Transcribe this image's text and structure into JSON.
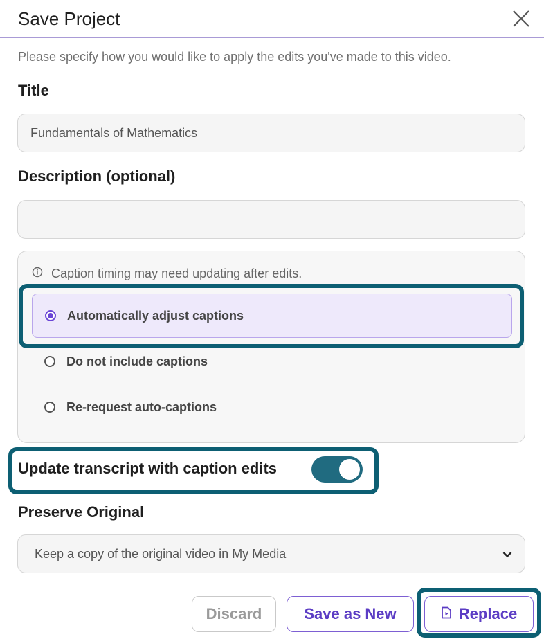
{
  "dialog": {
    "title": "Save Project",
    "subtitle": "Please specify how you would like to apply the edits you've made to this video."
  },
  "form": {
    "title_label": "Title",
    "title_value": "Fundamentals of Mathematics",
    "description_label": "Description (optional)",
    "description_value": ""
  },
  "captions": {
    "info": "Caption timing may need updating after edits.",
    "options": [
      {
        "label": "Automatically adjust captions",
        "selected": true
      },
      {
        "label": "Do not include captions",
        "selected": false
      },
      {
        "label": "Re-request auto-captions",
        "selected": false
      }
    ]
  },
  "transcript": {
    "label": "Update transcript with caption edits",
    "enabled": true
  },
  "preserve": {
    "label": "Preserve Original",
    "selected": "Keep a copy of the original video in My Media"
  },
  "buttons": {
    "discard": "Discard",
    "save_new": "Save as New",
    "replace": "Replace"
  },
  "icons": {
    "close": "close-icon",
    "info": "info-icon",
    "dropdown": "chevron-down-icon",
    "replace": "video-file-icon"
  },
  "colors": {
    "accent": "#6a45d6",
    "highlight": "#0d5f73",
    "toggle": "#206b80",
    "selected_bg": "#eee9fb"
  }
}
